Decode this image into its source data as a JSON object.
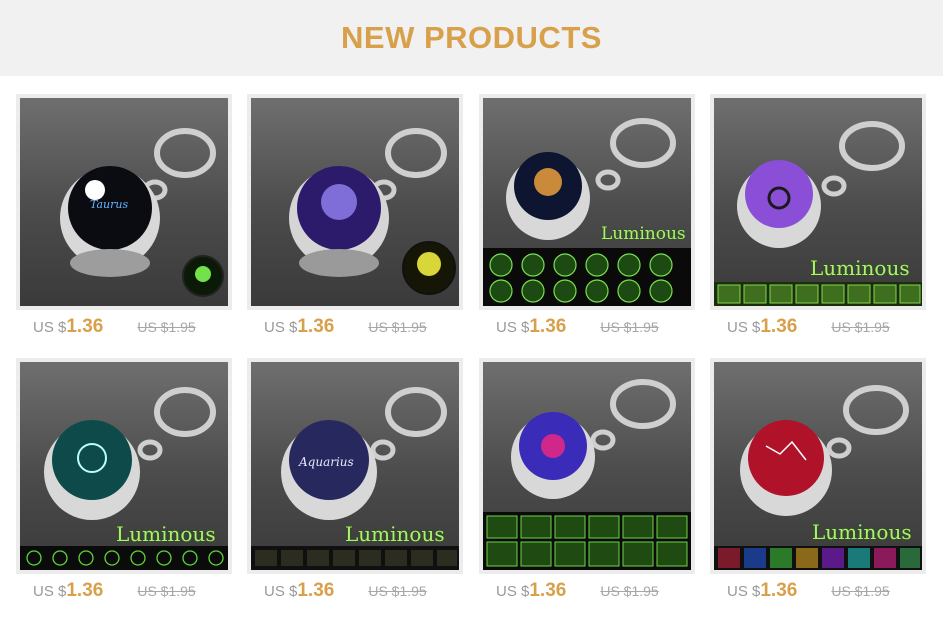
{
  "header": {
    "title": "NEW PRODUCTS"
  },
  "products": [
    {
      "sign": "taurus",
      "overlay": "",
      "price_prefix": "US $",
      "price": "1.36",
      "old_price": "US $1.95"
    },
    {
      "sign": "leo",
      "overlay": "",
      "price_prefix": "US $",
      "price": "1.36",
      "old_price": "US $1.95"
    },
    {
      "sign": "leo-star",
      "overlay": "Luminous",
      "price_prefix": "US $",
      "price": "1.36",
      "old_price": "US $1.95"
    },
    {
      "sign": "taurus-purple",
      "overlay": "Luminous",
      "price_prefix": "US $",
      "price": "1.36",
      "old_price": "US $1.95"
    },
    {
      "sign": "capricorn",
      "overlay": "Luminous",
      "price_prefix": "US $",
      "price": "1.36",
      "old_price": "US $1.95"
    },
    {
      "sign": "aquarius",
      "overlay": "Luminous",
      "price_prefix": "US $",
      "price": "1.36",
      "old_price": "US $1.95"
    },
    {
      "sign": "aries",
      "overlay": "",
      "price_prefix": "US $",
      "price": "1.36",
      "old_price": "US $1.95"
    },
    {
      "sign": "aquarius-red",
      "overlay": "Luminous",
      "price_prefix": "US $",
      "price": "1.36",
      "old_price": "US $1.95"
    }
  ],
  "sign_labels": {
    "taurus": "Taurus",
    "aquarius": "Aquarius"
  },
  "colors": {
    "accent": "#d9a04c",
    "header_bg": "#f1f1f1",
    "muted": "#999999",
    "luminous": "#a8f36a"
  }
}
